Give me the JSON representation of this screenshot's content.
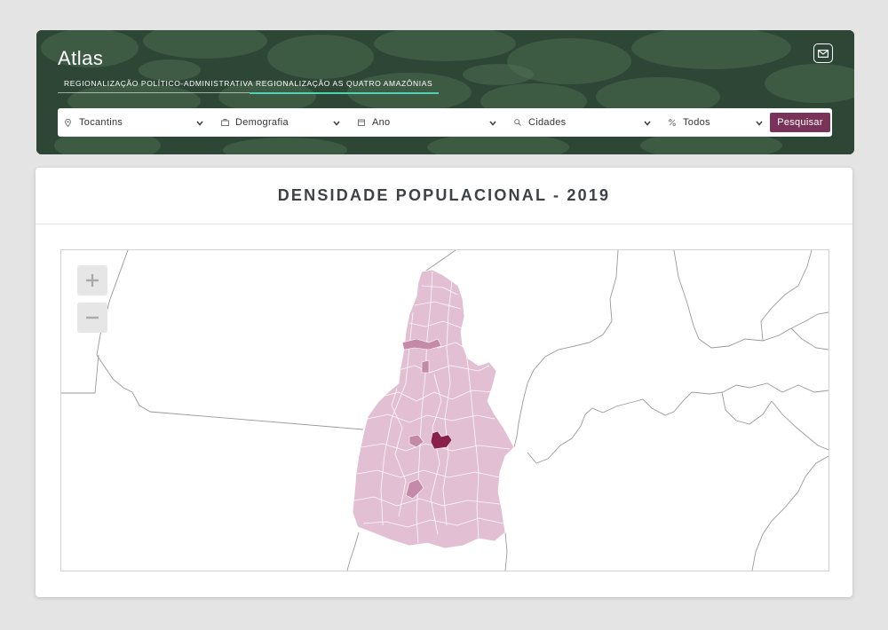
{
  "app": {
    "title": "Atlas"
  },
  "tabs": [
    {
      "label": "REGIONALIZAÇÃO POLÍTICO-ADMINISTRATIVA",
      "active": false
    },
    {
      "label": "REGIONALIZAÇÃO AS QUATRO AMAZÔNIAS",
      "active": true
    }
  ],
  "filters": {
    "estado": {
      "icon": "location-pin-icon",
      "value": "Tocantins"
    },
    "tema": {
      "icon": "briefcase-icon",
      "value": "Demografia"
    },
    "ano": {
      "icon": "calendar-icon",
      "value": "Ano"
    },
    "cidades": {
      "icon": "search-icon",
      "value": "Cidades"
    },
    "indicador": {
      "icon": "percent-icon",
      "value": "Todos"
    },
    "search_button": "Pesquisar"
  },
  "map_card": {
    "title": "DENSIDADE POPULACIONAL - 2019",
    "region": "Tocantins",
    "zoom_in": "+",
    "zoom_out": "−"
  },
  "colors": {
    "accent": "#7a3358",
    "active_tab_underline": "#4fd1b0",
    "density_low": "#e2bfd2",
    "density_mid": "#c48aa7",
    "density_high": "#8a1f4a",
    "border_lines": "#9a9a9a"
  }
}
